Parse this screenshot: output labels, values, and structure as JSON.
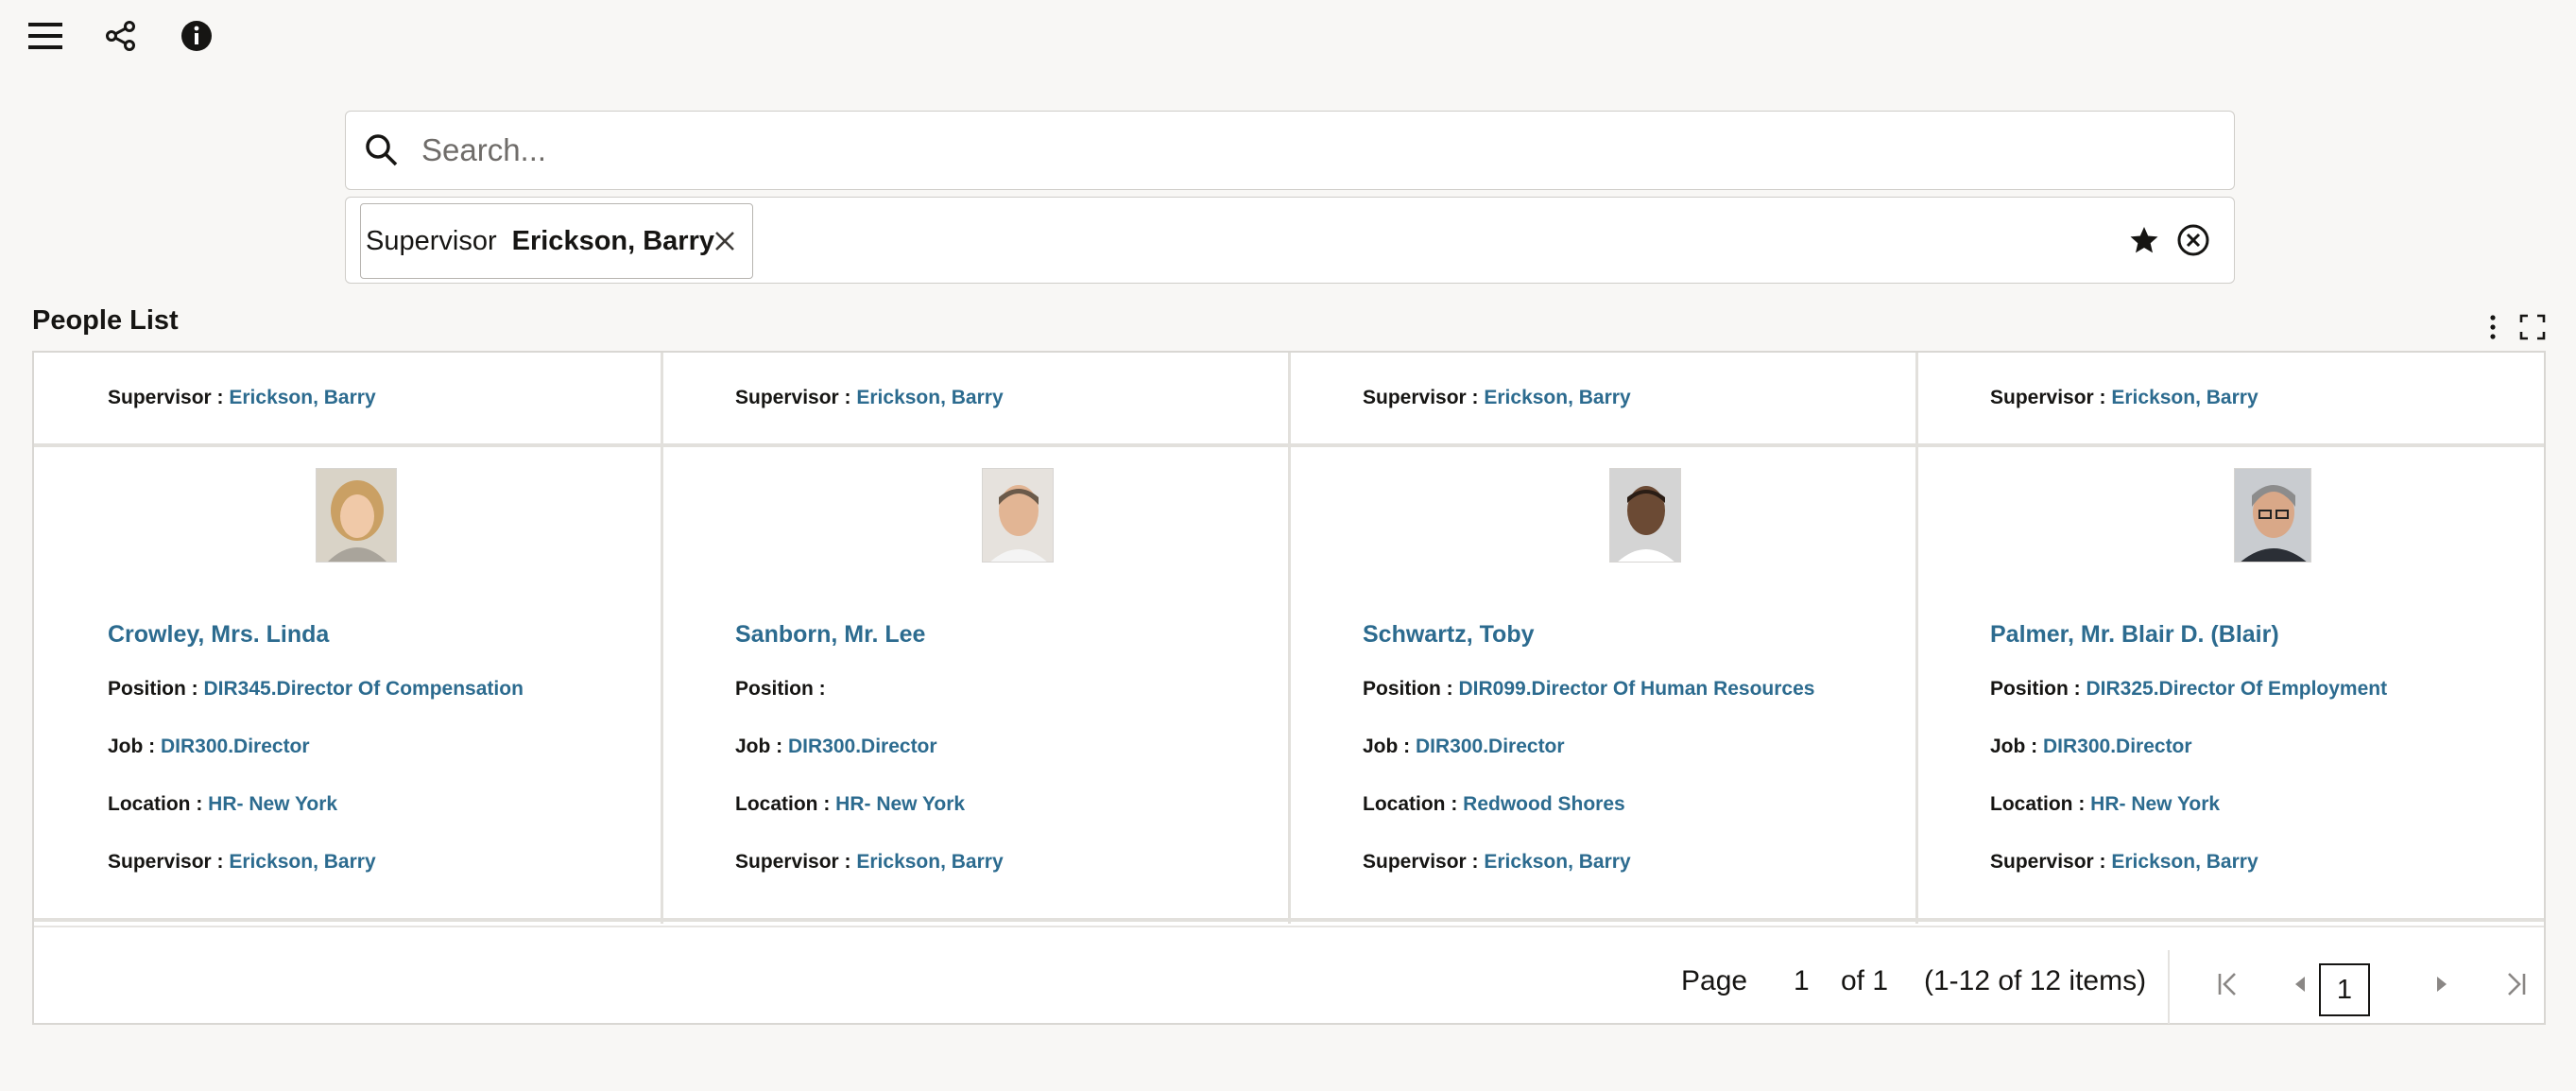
{
  "toolbar": {
    "icons": [
      "hamburger-menu-icon",
      "share-icon",
      "info-icon"
    ]
  },
  "search": {
    "placeholder": "Search..."
  },
  "filter": {
    "chip_label": "Supervisor",
    "chip_value": "Erickson, Barry"
  },
  "section": {
    "title": "People List"
  },
  "labels": {
    "supervisor": "Supervisor : ",
    "position": "Position : ",
    "job": "Job : ",
    "location": "Location : "
  },
  "top_row": [
    {
      "supervisor": "Erickson, Barry"
    },
    {
      "supervisor": "Erickson, Barry"
    },
    {
      "supervisor": "Erickson, Barry"
    },
    {
      "supervisor": "Erickson, Barry"
    }
  ],
  "people": [
    {
      "name": "Crowley, Mrs. Linda",
      "position": "DIR345.Director Of Compensation",
      "job": "DIR300.Director",
      "location": "HR- New York",
      "supervisor": "Erickson, Barry"
    },
    {
      "name": "Sanborn, Mr. Lee",
      "position": "",
      "job": "DIR300.Director",
      "location": "HR- New York",
      "supervisor": "Erickson, Barry"
    },
    {
      "name": "Schwartz, Toby",
      "position": "DIR099.Director Of Human Resources",
      "job": "DIR300.Director",
      "location": "Redwood Shores",
      "supervisor": "Erickson, Barry"
    },
    {
      "name": "Palmer, Mr. Blair D. (Blair)",
      "position": "DIR325.Director Of Employment",
      "job": "DIR300.Director",
      "location": "HR- New York",
      "supervisor": "Erickson, Barry"
    }
  ],
  "pager": {
    "page_label": "Page",
    "current_page": "1",
    "of_label": "of 1",
    "items_summary": "(1-12 of 12 items)",
    "page_button": "1"
  }
}
